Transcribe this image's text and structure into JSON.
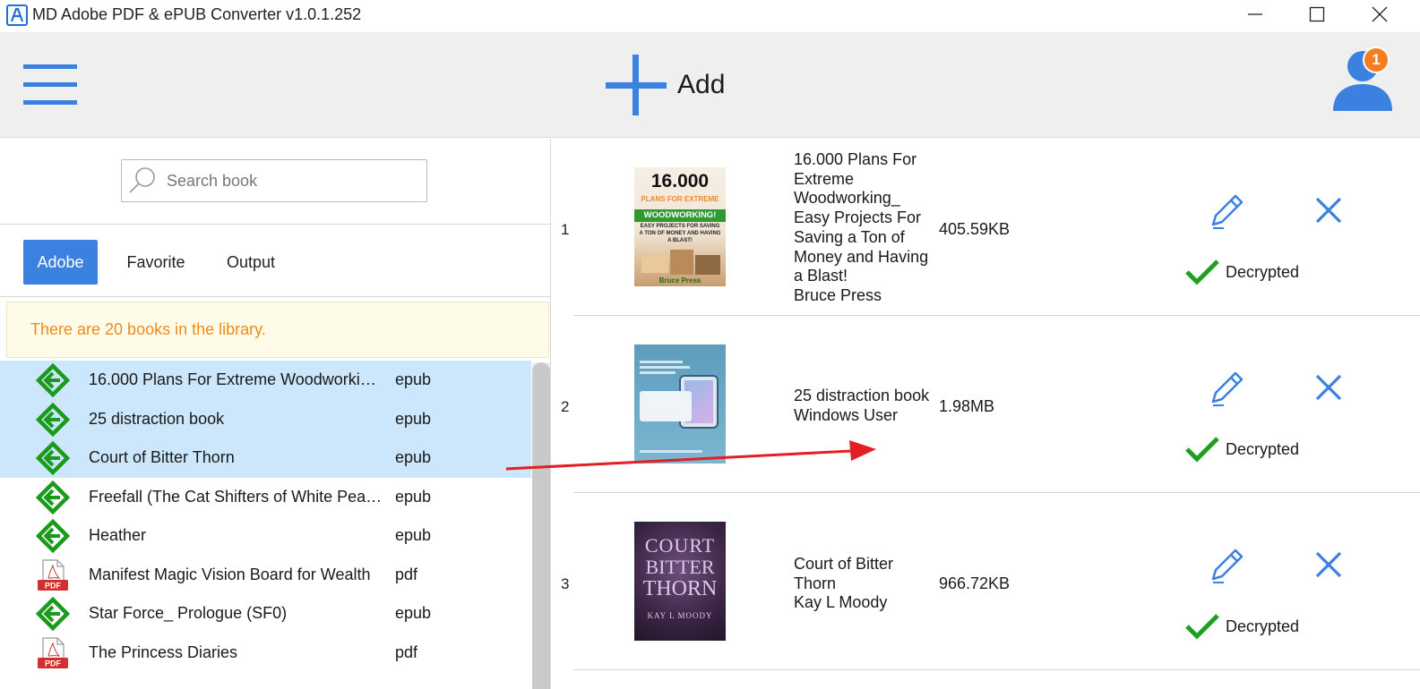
{
  "window": {
    "title": "MD Adobe PDF & ePUB Converter v1.0.1.252"
  },
  "toolbar": {
    "add_label": "Add",
    "notification_count": "1"
  },
  "search": {
    "placeholder": "Search book",
    "value": ""
  },
  "tabs": [
    {
      "label": "Adobe",
      "active": true
    },
    {
      "label": "Favorite",
      "active": false
    },
    {
      "label": "Output",
      "active": false
    }
  ],
  "library_notice": "There are 20 books in the library.",
  "books": [
    {
      "title": "16.000 Plans For Extreme Woodworkin…",
      "format": "epub",
      "icon": "epub-icon",
      "selected": true
    },
    {
      "title": "25 distraction book",
      "format": "epub",
      "icon": "epub-icon",
      "selected": true
    },
    {
      "title": "Court of Bitter Thorn",
      "format": "epub",
      "icon": "epub-icon",
      "selected": true
    },
    {
      "title": "Freefall (The Cat Shifters of White Pea…",
      "format": "epub",
      "icon": "epub-icon",
      "selected": false
    },
    {
      "title": "Heather",
      "format": "epub",
      "icon": "epub-icon",
      "selected": false
    },
    {
      "title": "Manifest Magic Vision Board for Wealth",
      "format": "pdf",
      "icon": "pdf-icon",
      "selected": false
    },
    {
      "title": "Star Force_ Prologue (SF0)",
      "format": "epub",
      "icon": "epub-icon",
      "selected": false
    },
    {
      "title": "The Princess Diaries",
      "format": "pdf",
      "icon": "pdf-icon",
      "selected": false
    }
  ],
  "pdf_icon_label": "PDF",
  "conversions": [
    {
      "number": "1",
      "title_lines": [
        "16.000 Plans For",
        "Extreme",
        "Woodworking_",
        "Easy Projects For",
        "Saving a Ton of",
        "Money and Having",
        "a Blast!"
      ],
      "author": "Bruce Press",
      "size": "405.59KB",
      "status": "Decrypted",
      "cover": {
        "headline": "16.000",
        "band": "PLANS FOR EXTREME",
        "band2": "WOODWORKING!",
        "sub": "EASY PROJECTS FOR SAVING A TON OF MONEY AND HAVING A BLAST!",
        "footer": "Bruce Press"
      }
    },
    {
      "number": "2",
      "title_lines": [
        "25 distraction book"
      ],
      "author": "Windows User",
      "size": "1.98MB",
      "status": "Decrypted",
      "cover": {}
    },
    {
      "number": "3",
      "title_lines": [
        "Court of Bitter",
        "Thorn"
      ],
      "author": "Kay L Moody",
      "size": "966.72KB",
      "status": "Decrypted",
      "cover": {
        "line1": "COURT",
        "line2": "BITTER",
        "line3": "THORN",
        "author": "KAY L MOODY"
      }
    }
  ],
  "colors": {
    "accent_blue": "#3b82e0",
    "epub_green": "#1a9a1a",
    "pdf_red": "#d32f2f",
    "notice_orange": "#f08a1c",
    "badge_orange": "#f57c1f",
    "check_green": "#1f9e1f",
    "arrow_red": "#e31e24"
  }
}
